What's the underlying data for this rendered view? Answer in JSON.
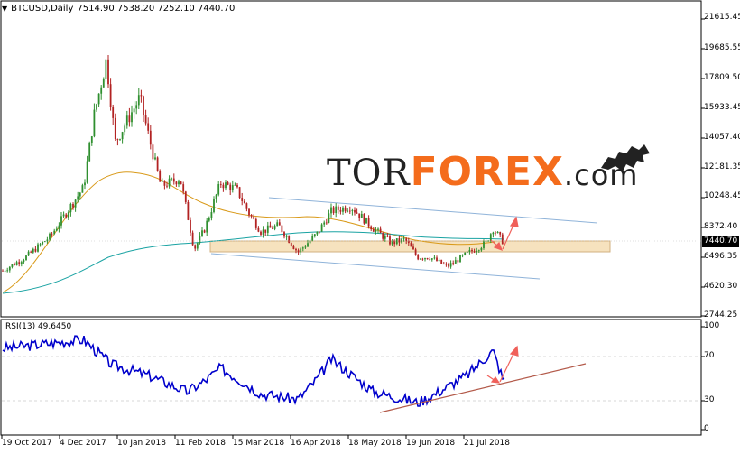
{
  "header": {
    "symbol": "BTCUSD,Daily",
    "ohlc": "7514.90 7538.20 7252.10 7440.70"
  },
  "rsi": {
    "label": "RSI(13) 49.6450",
    "levels": [
      "100",
      "70",
      "30",
      "0"
    ]
  },
  "price_axis": {
    "ticks": [
      "21615.45",
      "19685.55",
      "17809.50",
      "15933.45",
      "14057.40",
      "12181.35",
      "10248.45",
      "8372.40",
      "6496.35",
      "4620.30",
      "2744.25"
    ],
    "current_price": "7440.70"
  },
  "x_axis": {
    "ticks": [
      "19 Oct 2017",
      "4 Dec 2017",
      "10 Jan 2018",
      "11 Feb 2018",
      "15 Mar 2018",
      "16 Apr 2018",
      "18 May 2018",
      "19 Jun 2018",
      "21 Jul 2018"
    ]
  },
  "watermark": {
    "part1": "TOR",
    "part2": "FOREX",
    "part3": ".com",
    "icon": "bull-bear-icon"
  },
  "colors": {
    "bull_candle": "#2f8f2f",
    "bear_candle": "#b22222",
    "ma_fast": "#d99a1a",
    "ma_slow": "#1aa3a3",
    "channel": "#8fb3d9",
    "support_zone": "#f5deb3",
    "rsi_line": "#0000cc",
    "rsi_trend": "#b35a4a",
    "arrow": "#f0605a",
    "brand_orange": "#f46c1c"
  },
  "chart_data": {
    "type": "line",
    "title": "BTCUSD,Daily",
    "x": [
      "19 Oct 2017",
      "4 Dec 2017",
      "10 Jan 2018",
      "11 Feb 2018",
      "15 Mar 2018",
      "16 Apr 2018",
      "18 May 2018",
      "19 Jun 2018",
      "21 Jul 2018"
    ],
    "ylim": [
      2744.25,
      22500
    ],
    "series": [
      {
        "values": [
          5650,
          10900,
          14200,
          8300,
          8100,
          8000,
          8300,
          6500,
          7440
        ]
      }
    ],
    "close_path": [
      [
        "19 Oct 2017",
        5650
      ],
      [
        "1 Nov 2017",
        6500
      ],
      [
        "15 Nov 2017",
        7800
      ],
      [
        "4 Dec 2017",
        10900
      ],
      [
        "10 Dec 2017",
        15500
      ],
      [
        "17 Dec 2017",
        19000
      ],
      [
        "22 Dec 2017",
        13800
      ],
      [
        "28 Dec 2017",
        15000
      ],
      [
        "5 Jan 2018",
        16600
      ],
      [
        "10 Jan 2018",
        14200
      ],
      [
        "17 Jan 2018",
        11000
      ],
      [
        "28 Jan 2018",
        11500
      ],
      [
        "5 Feb 2018",
        7000
      ],
      [
        "11 Feb 2018",
        8300
      ],
      [
        "20 Feb 2018",
        11200
      ],
      [
        "1 Mar 2018",
        10800
      ],
      [
        "8 Mar 2018",
        9300
      ],
      [
        "15 Mar 2018",
        8100
      ],
      [
        "25 Mar 2018",
        8500
      ],
      [
        "5 Apr 2018",
        6800
      ],
      [
        "16 Apr 2018",
        8000
      ],
      [
        "24 Apr 2018",
        9400
      ],
      [
        "5 May 2018",
        9700
      ],
      [
        "18 May 2018",
        8300
      ],
      [
        "28 May 2018",
        7400
      ],
      [
        "5 Jun 2018",
        7600
      ],
      [
        "12 Jun 2018",
        6500
      ],
      [
        "19 Jun 2018",
        6500
      ],
      [
        "29 Jun 2018",
        5900
      ],
      [
        "10 Jul 2018",
        6700
      ],
      [
        "21 Jul 2018",
        7400
      ],
      [
        "25 Jul 2018",
        8300
      ],
      [
        "31 Jul 2018",
        7440
      ]
    ],
    "rsi_path": [
      [
        "19 Oct 2017",
        80
      ],
      [
        "4 Dec 2017",
        88
      ],
      [
        "20 Dec 2017",
        65
      ],
      [
        "10 Jan 2018",
        55
      ],
      [
        "1 Feb 2018",
        40
      ],
      [
        "11 Feb 2018",
        50
      ],
      [
        "20 Feb 2018",
        62
      ],
      [
        "15 Mar 2018",
        38
      ],
      [
        "5 Apr 2018",
        33
      ],
      [
        "16 Apr 2018",
        52
      ],
      [
        "24 Apr 2018",
        70
      ],
      [
        "18 May 2018",
        40
      ],
      [
        "12 Jun 2018",
        30
      ],
      [
        "19 Jun 2018",
        35
      ],
      [
        "10 Jul 2018",
        55
      ],
      [
        "25 Jul 2018",
        78
      ],
      [
        "31 Jul 2018",
        50
      ]
    ]
  }
}
